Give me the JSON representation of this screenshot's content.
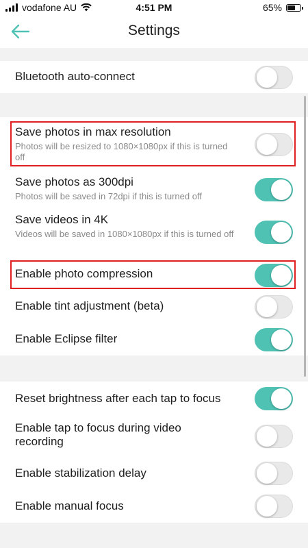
{
  "status_bar": {
    "carrier": "vodafone AU",
    "time": "4:51 PM",
    "battery": "65%",
    "battery_level": 0.65,
    "icons": [
      "signal-icon",
      "wifi-icon",
      "battery-icon"
    ]
  },
  "header": {
    "back_icon": "arrow-left-icon",
    "title": "Settings"
  },
  "colors": {
    "accent": "#4fc2b4",
    "highlight": "#e02020"
  },
  "settings": [
    {
      "title": "Bluetooth auto-connect",
      "subtitle": "",
      "on": false
    },
    {
      "title": "Save photos in max resolution",
      "subtitle": "Photos will be resized to 1080×1080px if this is turned off",
      "on": false,
      "highlighted": true
    },
    {
      "title": "Save photos as 300dpi",
      "subtitle": "Photos will be saved in 72dpi if this is turned off",
      "on": true
    },
    {
      "title": "Save videos in 4K",
      "subtitle": "Videos will be saved in 1080×1080px if this is turned off",
      "on": true
    },
    {
      "title": "Enable photo compression",
      "subtitle": "",
      "on": true,
      "highlighted": true
    },
    {
      "title": "Enable tint adjustment (beta)",
      "subtitle": "",
      "on": false
    },
    {
      "title": "Enable Eclipse filter",
      "subtitle": "",
      "on": true
    },
    {
      "title": "Reset brightness after each tap to focus",
      "subtitle": "",
      "on": true
    },
    {
      "title": "Enable tap to focus during video recording",
      "subtitle": "",
      "on": false
    },
    {
      "title": "Enable stabilization delay",
      "subtitle": "",
      "on": false
    },
    {
      "title": "Enable manual focus",
      "subtitle": "",
      "on": false
    }
  ]
}
